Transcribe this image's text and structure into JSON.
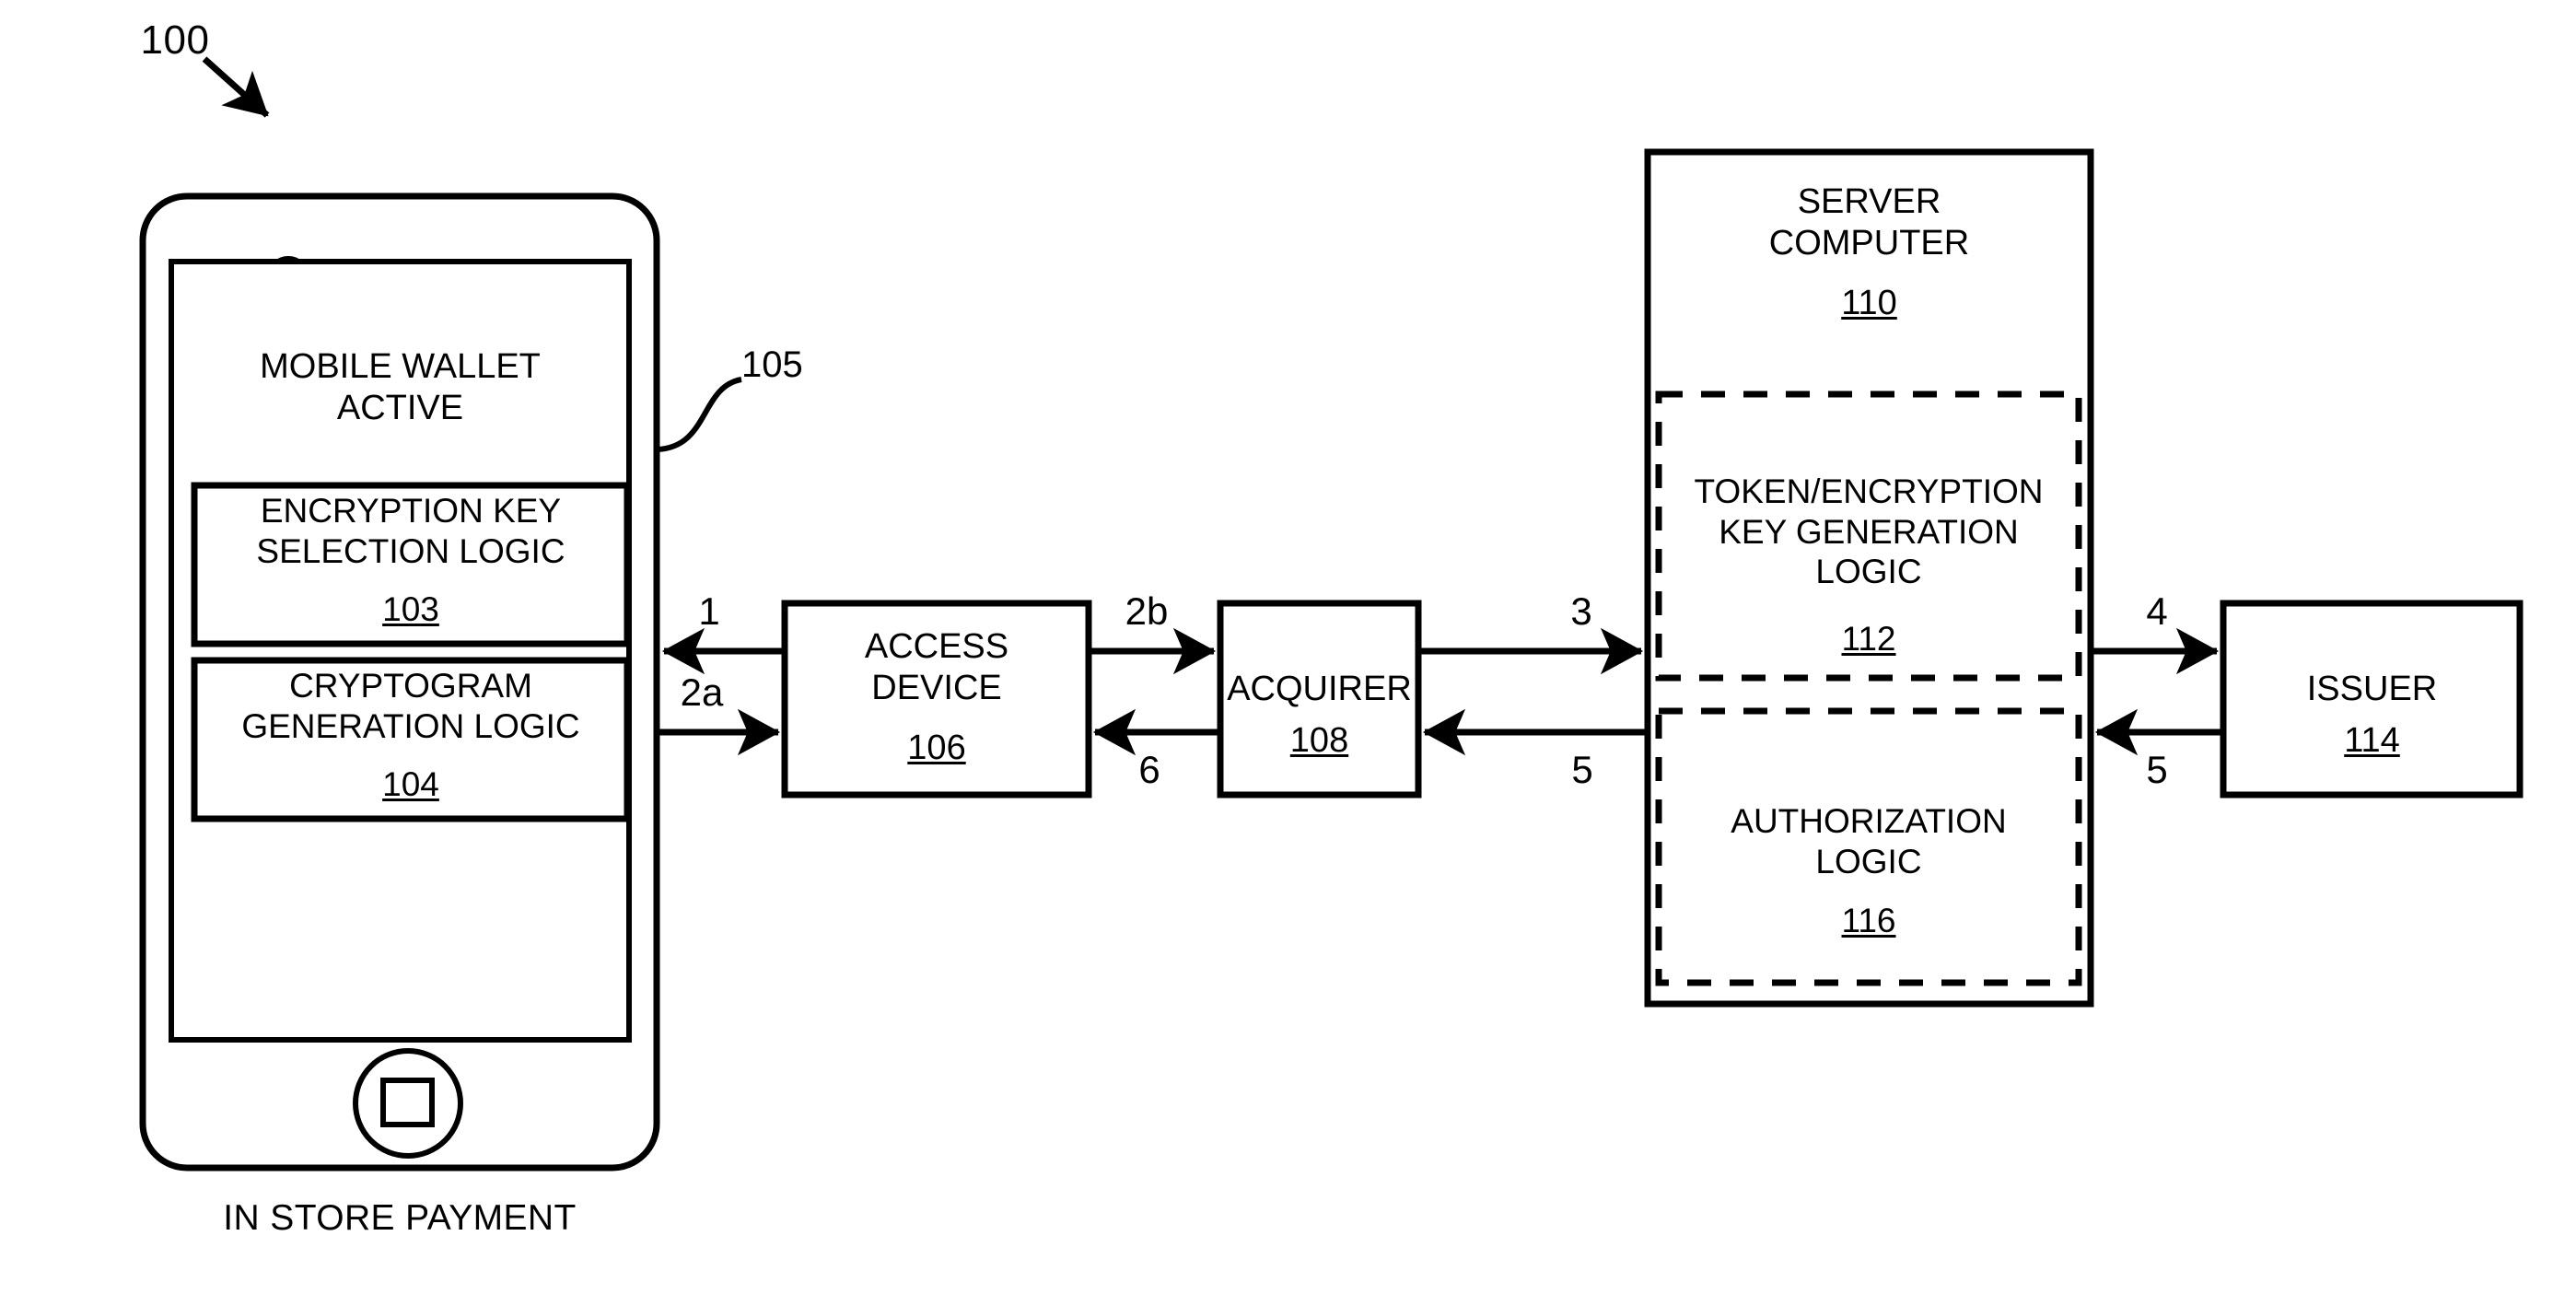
{
  "figure": {
    "reference_number": "100",
    "caption": "IN STORE PAYMENT"
  },
  "mobile_device": {
    "lead_number": "105",
    "screen_title": "MOBILE WALLET\nACTIVE",
    "modules": [
      {
        "label": "ENCRYPTION KEY\nSELECTION LOGIC",
        "number": "103"
      },
      {
        "label": "CRYPTOGRAM\nGENERATION LOGIC",
        "number": "104"
      }
    ],
    "hardware": {
      "camera": "camera-icon",
      "speaker": "speaker-grille-icon",
      "sensor": "proximity-sensor-icon",
      "home_button": "home-button-icon"
    }
  },
  "nodes": [
    {
      "id": "access_device",
      "label": "ACCESS\nDEVICE",
      "number": "106"
    },
    {
      "id": "acquirer",
      "label": "ACQUIRER",
      "number": "108"
    },
    {
      "id": "server_computer",
      "label": "SERVER\nCOMPUTER",
      "number": "110"
    },
    {
      "id": "issuer",
      "label": "ISSUER",
      "number": "114"
    }
  ],
  "server_modules": [
    {
      "id": "token_key_logic",
      "label": "TOKEN/ENCRYPTION\nKEY GENERATION\nLOGIC",
      "number": "112"
    },
    {
      "id": "authorization_logic",
      "label": "AUTHORIZATION\nLOGIC",
      "number": "116"
    }
  ],
  "flow_steps": [
    {
      "label": "1",
      "from": "access_device",
      "to": "mobile_device",
      "direction": "left"
    },
    {
      "label": "2a",
      "from": "mobile_device",
      "to": "access_device",
      "direction": "right"
    },
    {
      "label": "2b",
      "from": "access_device",
      "to": "acquirer",
      "direction": "right"
    },
    {
      "label": "6",
      "from": "acquirer",
      "to": "access_device",
      "direction": "left"
    },
    {
      "label": "3",
      "from": "acquirer",
      "to": "server_computer",
      "direction": "right"
    },
    {
      "label": "5",
      "from": "server_computer",
      "to": "acquirer",
      "direction": "left"
    },
    {
      "label": "4",
      "from": "server_computer",
      "to": "issuer",
      "direction": "right"
    },
    {
      "label": "5",
      "from": "issuer",
      "to": "server_computer",
      "direction": "left"
    }
  ],
  "style": {
    "stroke": "#000000",
    "background": "#ffffff"
  }
}
